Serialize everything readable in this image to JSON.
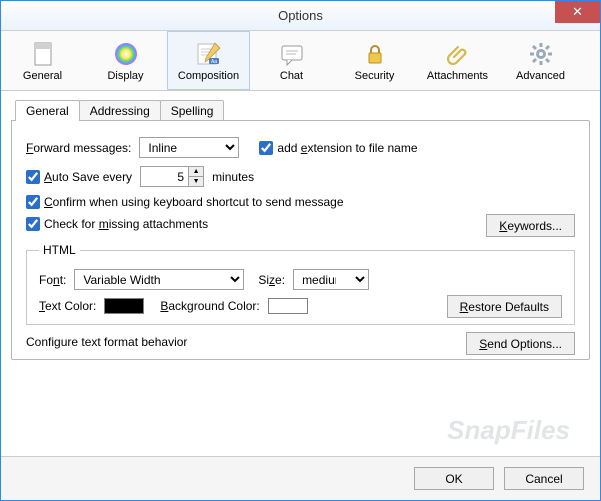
{
  "window": {
    "title": "Options"
  },
  "toolbar": {
    "items": [
      {
        "label": "General"
      },
      {
        "label": "Display"
      },
      {
        "label": "Composition"
      },
      {
        "label": "Chat"
      },
      {
        "label": "Security"
      },
      {
        "label": "Attachments"
      },
      {
        "label": "Advanced"
      }
    ]
  },
  "tabs": {
    "general": "General",
    "addressing": "Addressing",
    "spelling": "Spelling"
  },
  "main": {
    "forward_label": "Forward messages:",
    "forward_value": "Inline",
    "add_ext_checked": true,
    "add_ext_label": "add extension to file name",
    "autosave_checked": true,
    "autosave_label": "Auto Save every",
    "autosave_value": "5",
    "autosave_minutes": "minutes",
    "confirm_checked": true,
    "confirm_label": "Confirm when using keyboard shortcut to send message",
    "missing_checked": true,
    "missing_label": "Check for missing attachments",
    "keywords_btn": "Keywords...",
    "html_legend": "HTML",
    "font_label": "Font:",
    "font_value": "Variable Width",
    "size_label": "Size:",
    "size_value": "medium",
    "text_color_label": "Text Color:",
    "text_color": "#000000",
    "bg_color_label": "Background Color:",
    "bg_color": "#ffffff",
    "restore_btn": "Restore Defaults",
    "configure_label": "Configure text format behavior",
    "send_options_btn": "Send Options..."
  },
  "footer": {
    "ok": "OK",
    "cancel": "Cancel"
  },
  "watermark": "SnapFiles"
}
